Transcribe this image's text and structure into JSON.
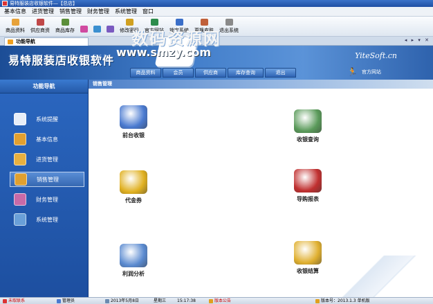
{
  "window": {
    "title": "易特服装店收银软件—【总店】"
  },
  "menubar": [
    "基本信息",
    "进货管理",
    "销售管理",
    "财务管理",
    "系统管理",
    "窗口"
  ],
  "toolbar": [
    {
      "label": "商品资料",
      "icon": "goods-icon",
      "color": "#e7a23a"
    },
    {
      "label": "供应商资",
      "icon": "supplier-icon",
      "color": "#c04848"
    },
    {
      "label": "商品库存",
      "icon": "stock-icon",
      "color": "#5c8f3a"
    },
    {
      "label": "",
      "icon": "gift-icon",
      "color": "#d04aa0"
    },
    {
      "label": "",
      "icon": "chart-icon",
      "color": "#3a8fd0"
    },
    {
      "label": "",
      "icon": "user-icon",
      "color": "#7a5ac0"
    },
    {
      "label": "修改密码",
      "icon": "key-icon",
      "color": "#d0a020"
    },
    {
      "label": "官方网站",
      "icon": "globe-icon",
      "color": "#2c8c4c"
    },
    {
      "label": "锁定系统",
      "icon": "lock-icon",
      "color": "#3a6ec8"
    },
    {
      "label": "更换皮肤",
      "icon": "skin-icon",
      "color": "#c0603a"
    },
    {
      "label": "退出系统",
      "icon": "exit-icon",
      "color": "#8a8a8a"
    }
  ],
  "tabs": {
    "active": "功能导航",
    "controls": "◂ ▸ ▾ ✕"
  },
  "banner": {
    "brand": "易特服装店收银软件",
    "company": "YiteSoft.cn",
    "nav": [
      "商品资料",
      "会员",
      "供应商",
      "库存查询",
      "退出"
    ],
    "official_site": "官方网站"
  },
  "watermark": {
    "cn": "数码资源网",
    "url": "www.smzy.com"
  },
  "sidebar": {
    "title": "功能导航",
    "items": [
      {
        "label": "系统提醒",
        "icon": "clock-icon",
        "color": "#e8eef8"
      },
      {
        "label": "基本信息",
        "icon": "boxes-icon",
        "color": "#e2a030"
      },
      {
        "label": "进货管理",
        "icon": "folder-icon",
        "color": "#e8b040"
      },
      {
        "label": "销售管理",
        "icon": "sales-icon",
        "color": "#e0a030"
      },
      {
        "label": "财务管理",
        "icon": "money-icon",
        "color": "#c86aa8"
      },
      {
        "label": "系统管理",
        "icon": "monitor-icon",
        "color": "#6aa0d8"
      }
    ],
    "active_index": 3
  },
  "content": {
    "title": "销售管理",
    "functions": [
      {
        "label": "前台收银",
        "icon": "pos-terminal-icon",
        "color": "#4a7ad0"
      },
      {
        "label": "收银查询",
        "icon": "search-report-icon",
        "color": "#5a9a5a"
      },
      {
        "label": "代金券",
        "icon": "voucher-icon",
        "color": "#e0b020"
      },
      {
        "label": "导购报表",
        "icon": "salesperson-icon",
        "color": "#c03030"
      },
      {
        "label": "利润分析",
        "icon": "profit-analysis-icon",
        "color": "#5a8ad0"
      },
      {
        "label": "收银结算",
        "icon": "coin-bag-icon",
        "color": "#e0b030"
      }
    ]
  },
  "statusbar": {
    "f1": "未取联系",
    "f2": "管理员",
    "date": "2013年5月8日",
    "weekday": "星期三",
    "time": "15:17:38",
    "notice": "版本公告",
    "version": "版本号：2013.1.3 单机版"
  }
}
